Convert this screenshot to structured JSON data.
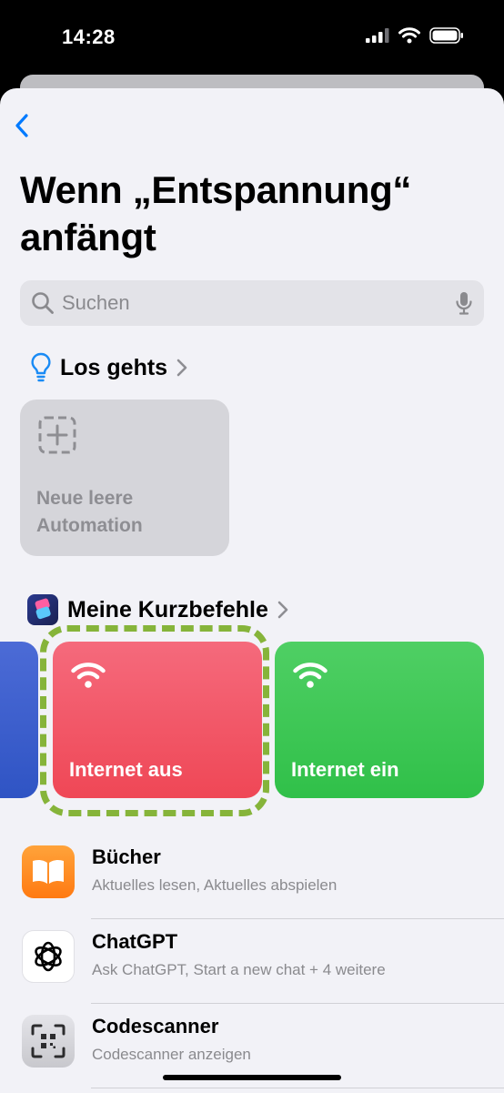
{
  "status_bar": {
    "time": "14:28",
    "icons": [
      "signal-icon",
      "wifi-icon",
      "battery-icon"
    ]
  },
  "nav": {
    "back_icon": "chevron-left-icon"
  },
  "page": {
    "title": "Wenn „Entspannung“ anfängt"
  },
  "search": {
    "placeholder": "Suchen",
    "icons": [
      "search-icon",
      "microphone-icon"
    ]
  },
  "sections": {
    "getting_started": {
      "title": "Los gehts",
      "icon": "lightbulb-icon",
      "tiles": [
        {
          "label_line1": "Neue leere",
          "label_line2": "Automation",
          "icon": "dashed-plus-icon"
        }
      ]
    },
    "my_shortcuts": {
      "title": "Meine Kurzbefehle",
      "icon": "shortcuts-app-icon",
      "cards": [
        {
          "label": "",
          "color": "#3f60cf",
          "icon": ""
        },
        {
          "label": "Internet aus",
          "color": "#f25866",
          "icon": "wifi-icon"
        },
        {
          "label": "Internet ein",
          "color": "#3dc856",
          "icon": "wifi-icon"
        }
      ]
    }
  },
  "apps": [
    {
      "name": "Bücher",
      "subtitle": "Aktuelles lesen, Aktuelles abspielen",
      "icon": "books-app-icon",
      "color": "#ff8a1e"
    },
    {
      "name": "ChatGPT",
      "subtitle": "Ask ChatGPT, Start a new chat + 4 weitere",
      "icon": "chatgpt-app-icon",
      "color": "#ffffff"
    },
    {
      "name": "Codescanner",
      "subtitle": "Codescanner anzeigen",
      "icon": "codescanner-app-icon",
      "color": "#d9d9de"
    }
  ],
  "colors": {
    "accent": "#007aff",
    "highlight": "#86b43a",
    "background": "#f2f2f7"
  }
}
